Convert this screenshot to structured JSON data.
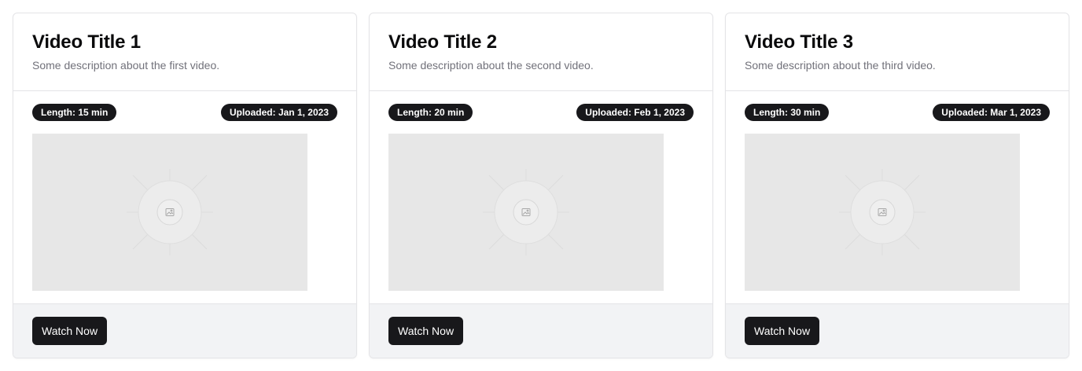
{
  "cards": [
    {
      "title": "Video Title 1",
      "description": "Some description about the first video.",
      "length_badge": "Length: 15 min",
      "uploaded_badge": "Uploaded: Jan 1, 2023",
      "thumbnail_icon": "image-placeholder-icon",
      "button_label": "Watch Now"
    },
    {
      "title": "Video Title 2",
      "description": "Some description about the second video.",
      "length_badge": "Length: 20 min",
      "uploaded_badge": "Uploaded: Feb 1, 2023",
      "thumbnail_icon": "image-placeholder-icon",
      "button_label": "Watch Now"
    },
    {
      "title": "Video Title 3",
      "description": "Some description about the third video.",
      "length_badge": "Length: 30 min",
      "uploaded_badge": "Uploaded: Mar 1, 2023",
      "thumbnail_icon": "image-placeholder-icon",
      "button_label": "Watch Now"
    }
  ],
  "colors": {
    "badge_bg": "#18181b",
    "button_bg": "#18181b",
    "footer_bg": "#f2f3f5",
    "thumbnail_bg": "#e7e7e7",
    "description_text": "#71717a"
  }
}
